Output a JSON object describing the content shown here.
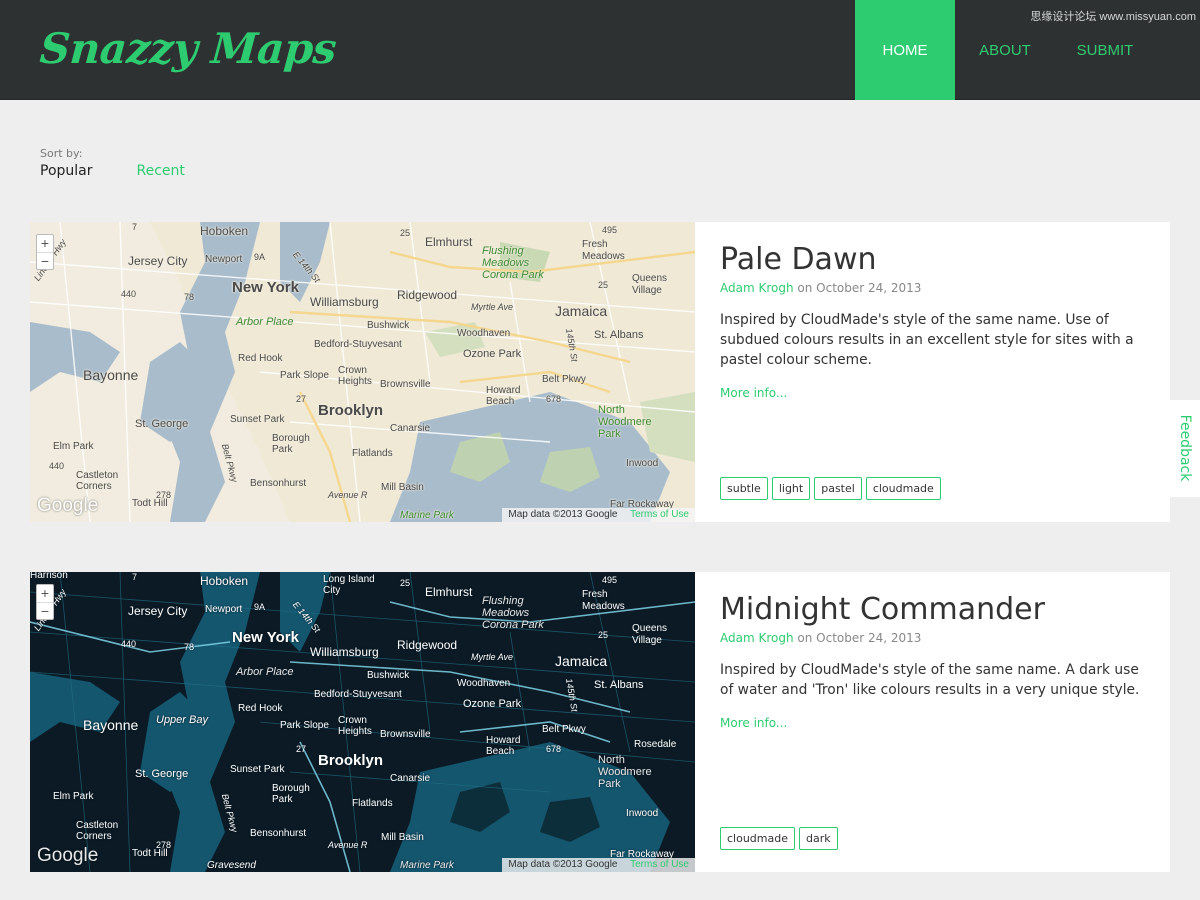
{
  "header": {
    "logo": "Snazzy Maps",
    "nav": [
      {
        "label": "HOME",
        "active": true
      },
      {
        "label": "ABOUT",
        "active": false
      },
      {
        "label": "SUBMIT",
        "active": false
      }
    ],
    "watermark": "思缘设计论坛 www.missyuan.com"
  },
  "sort": {
    "label": "Sort by:",
    "options": [
      {
        "label": "Popular",
        "selected": true
      },
      {
        "label": "Recent",
        "selected": false
      }
    ]
  },
  "maps": [
    {
      "title": "Pale Dawn",
      "author": "Adam Krogh",
      "date_text": "on October 24, 2013",
      "description": "Inspired by CloudMade's style of the same name. Use of subdued colours results in an excellent style for sites with a pastel colour scheme.",
      "more_link": "More info...",
      "tags": [
        "subtle",
        "light",
        "pastel",
        "cloudmade"
      ],
      "theme": "light"
    },
    {
      "title": "Midnight Commander",
      "author": "Adam Krogh",
      "date_text": "on October 24, 2013",
      "description": "Inspired by CloudMade's style of the same name. A dark use of water and 'Tron' like colours results in a very unique style.",
      "more_link": "More info...",
      "tags": [
        "cloudmade",
        "dark"
      ],
      "theme": "dark"
    }
  ],
  "map_common": {
    "zoom_in": "+",
    "zoom_out": "−",
    "google": "Google",
    "map_data": "Map data ©2013 Google",
    "terms": "Terms of Use",
    "labels": {
      "hoboken": "Hoboken",
      "jersey_city": "Jersey City",
      "newport": "Newport",
      "new_york": "New York",
      "williamsburg": "Williamsburg",
      "ridgewood": "Ridgewood",
      "elmhurst": "Elmhurst",
      "flushing": "Flushing Meadows Corona Park",
      "fresh_meadows": "Fresh Meadows",
      "queens_village": "Queens Village",
      "jamaica": "Jamaica",
      "st_albans": "St. Albans",
      "arbor_place": "Arbor Place",
      "bushwick": "Bushwick",
      "bedford": "Bedford-Stuyvesant",
      "woodhaven": "Woodhaven",
      "ozone_park": "Ozone Park",
      "red_hook": "Red Hook",
      "park_slope": "Park Slope",
      "crown_heights": "Crown Heights",
      "brownsville": "Brownsville",
      "bayonne": "Bayonne",
      "upper_bay": "Upper Bay",
      "brooklyn": "Brooklyn",
      "st_george": "St. George",
      "sunset_park": "Sunset Park",
      "canarsie": "Canarsie",
      "howard_beach": "Howard Beach",
      "belt_pkwy": "Belt Pkwy",
      "north_woodmere": "North Woodmere Park",
      "borough_park": "Borough Park",
      "flatlands": "Flatlands",
      "elm_park": "Elm Park",
      "castleton": "Castleton Corners",
      "bensonhurst": "Bensonhurst",
      "mill_basin": "Mill Basin",
      "inwood": "Inwood",
      "todt_hill": "Todt Hill",
      "marine_park": "Marine Park",
      "far_rockaway": "Far Rockaway",
      "gravesend": "Gravesend",
      "lincoln_hwy": "Lincoln Hwy",
      "e14th": "E 14th St",
      "myrtle": "Myrtle Ave",
      "st145": "145th St",
      "avenue_r": "Avenue R",
      "rosedale": "Rosedale",
      "harrison": "Harrison",
      "long_island_city": "Long Island City",
      "r7": "7",
      "r9a": "9A",
      "r440": "440",
      "r78": "78",
      "r27": "27",
      "r278": "278",
      "r495": "495",
      "r25": "25",
      "r678": "678"
    }
  }
}
